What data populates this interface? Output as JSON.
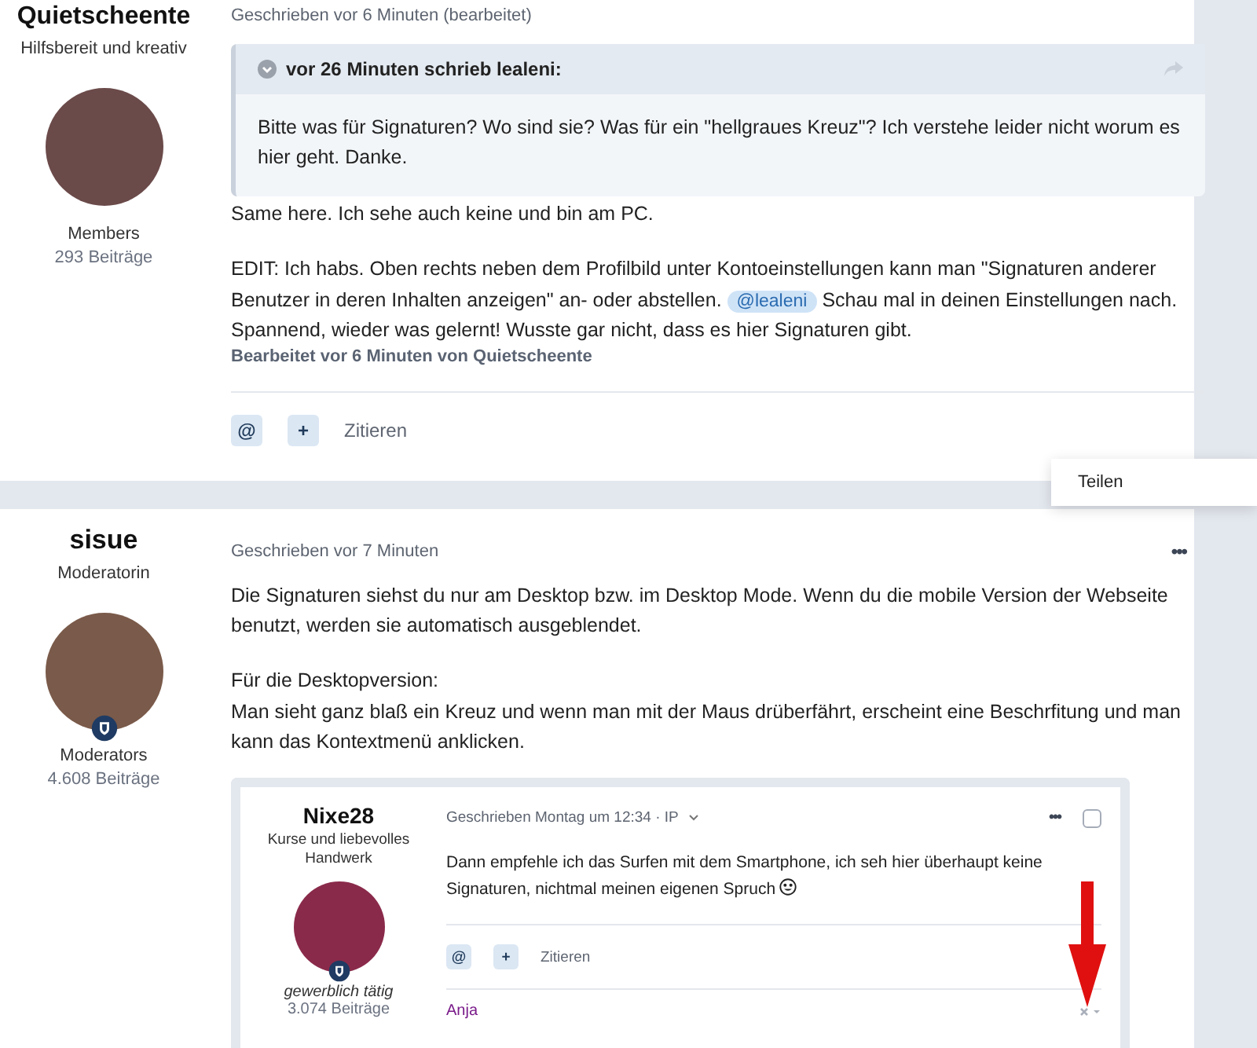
{
  "posts": [
    {
      "author": "Quietscheente",
      "tagline": "Hilfsbereit und kreativ",
      "group": "Members",
      "group_badge": false,
      "post_count": "293 Beiträge",
      "timestamp": "Geschrieben vor 6 Minuten (bearbeitet)",
      "quote": {
        "header": "vor 26 Minuten schrieb lealeni:",
        "body": "Bitte was für Signaturen? Wo sind sie? Was für ein  \"hellgraues Kreuz\"? Ich verstehe leider nicht worum es hier geht. Danke."
      },
      "paragraphs": [
        {
          "lines": [
            "Same here. Ich sehe auch keine und bin am PC."
          ]
        },
        {
          "before": "EDIT: Ich habs. Oben rechts neben dem Profilbild unter Kontoeinstellungen kann man \"Signaturen anderer Benutzer  in deren Inhalten anzeigen\" an- oder abstellen.",
          "mention": "@lealeni",
          "after": "Schau mal in deinen Einstellungen nach. Spannend, wieder was gelernt! Wusste gar nicht, dass es hier Signaturen gibt."
        }
      ],
      "edited_note": "Bearbeitet vor 6 Minuten von Quietscheente",
      "actions": [
        "@",
        "+",
        "Zitieren"
      ]
    },
    {
      "author": "sisue",
      "tagline": "Moderatorin",
      "group": "Moderators",
      "group_badge": true,
      "post_count": "4.608 Beiträge",
      "timestamp": "Geschrieben vor 7 Minuten",
      "menu": "•••",
      "paragraphs": [
        {
          "lines": [
            "Die Signaturen siehst du nur am Desktop bzw. im Desktop Mode. Wenn du die mobile Version der Webseite benutzt, werden sie automatisch ausgeblendet."
          ]
        },
        {
          "lines": [
            "Für die Desktopversion:",
            "Man sieht ganz blaß ein Kreuz und wenn man mit der Maus drüberfährt, erscheint eine Beschrfitung und man kann das Kontextmenü anklicken."
          ]
        }
      ],
      "screenshot": {
        "author": "Nixe28",
        "tagline": "Kurse und liebevolles Handwerk",
        "group": "gewerblich tätig",
        "post_count": "3.074 Beiträge",
        "timestamp": "Geschrieben Montag um 12:34 · IP",
        "menu": "•••",
        "checked": false,
        "body": "Dann empfehle ich das Surfen mit dem Smartphone, ich seh hier überhaupt keine Signaturen, nichtmal meinen eigenen Spruch",
        "actions": [
          "@",
          "+",
          "Zitieren"
        ],
        "signature": "Anja"
      }
    }
  ],
  "popover": {
    "items": [
      "Teilen"
    ]
  }
}
